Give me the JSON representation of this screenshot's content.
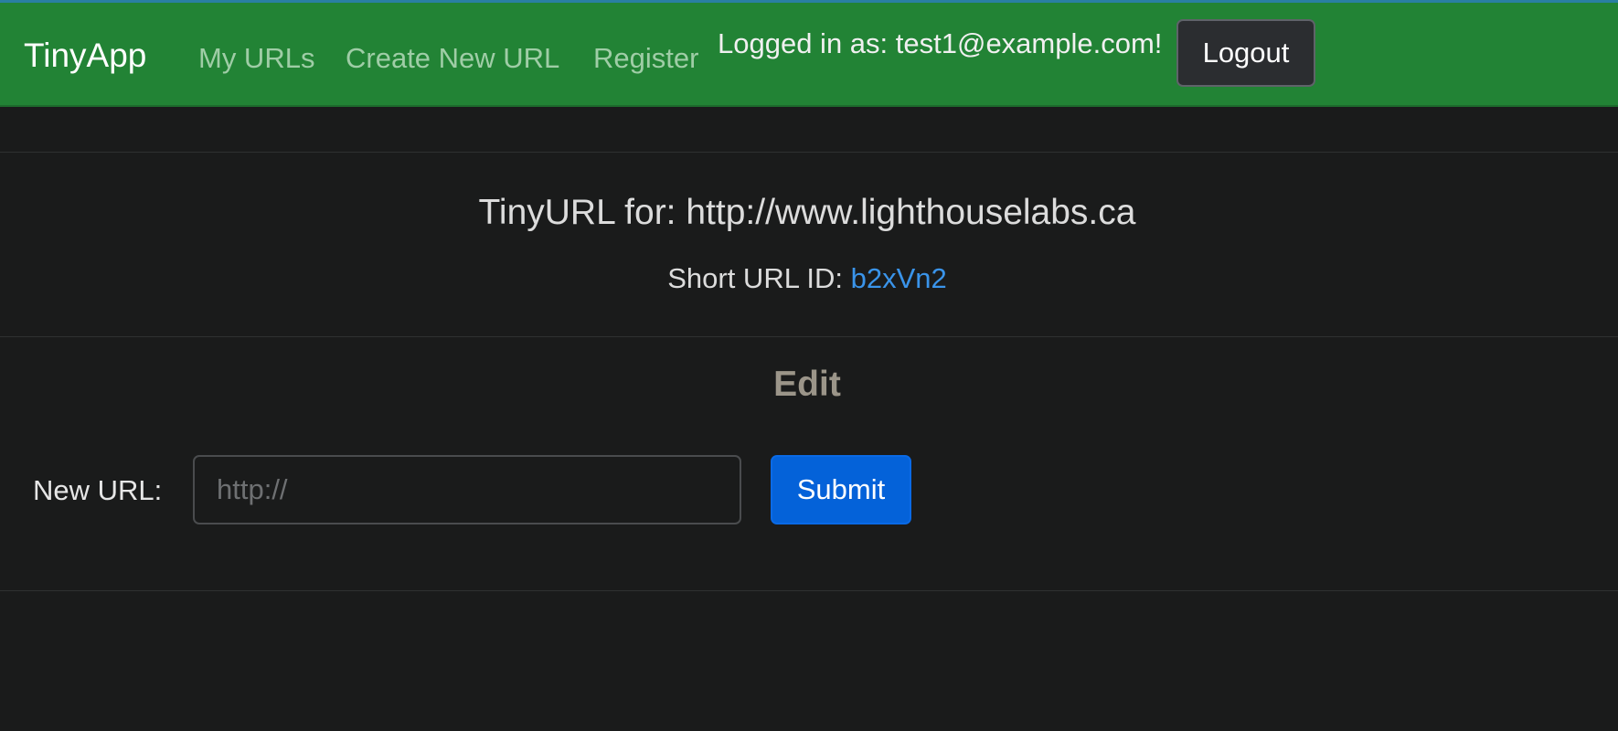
{
  "navbar": {
    "brand": "TinyApp",
    "links": [
      {
        "label": "My URLs"
      },
      {
        "label": "Create New URL"
      },
      {
        "label": "Register"
      }
    ],
    "logged_in_text": "Logged in as: test1@example.com!",
    "logout_label": "Logout",
    "background_color": "#228335"
  },
  "main": {
    "title": "TinyURL for: http://www.lighthouselabs.ca",
    "short_url_label": "Short URL ID: ",
    "short_url_id": "b2xVn2",
    "link_color": "#3a94ea"
  },
  "edit": {
    "heading": "Edit",
    "field_label": "New URL:",
    "input_value": "",
    "input_placeholder": "http://",
    "submit_label": "Submit",
    "submit_color": "#0462d9"
  }
}
